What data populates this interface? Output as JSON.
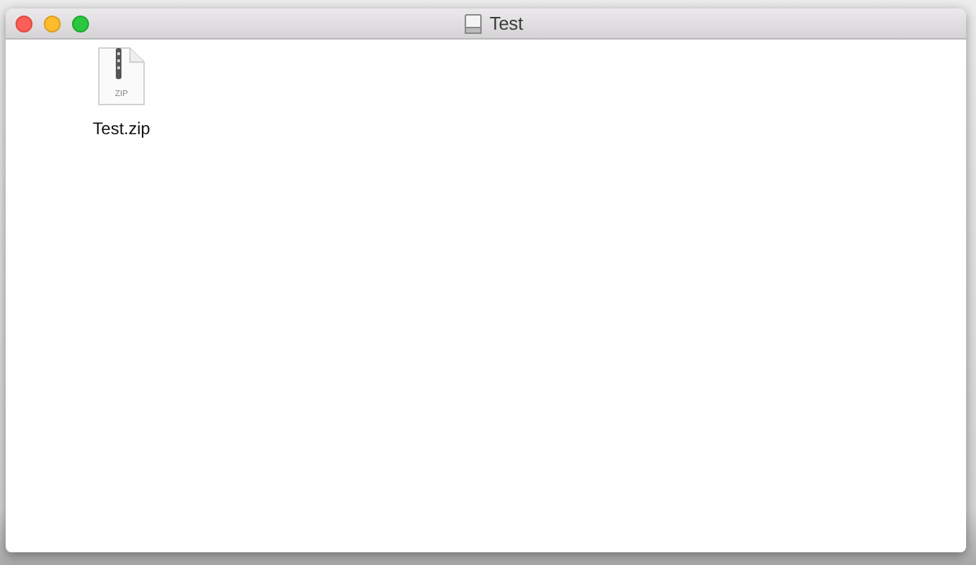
{
  "window": {
    "title": "Test"
  },
  "files": [
    {
      "name": "Test.zip",
      "kind": "zip",
      "badge": "ZIP"
    }
  ]
}
